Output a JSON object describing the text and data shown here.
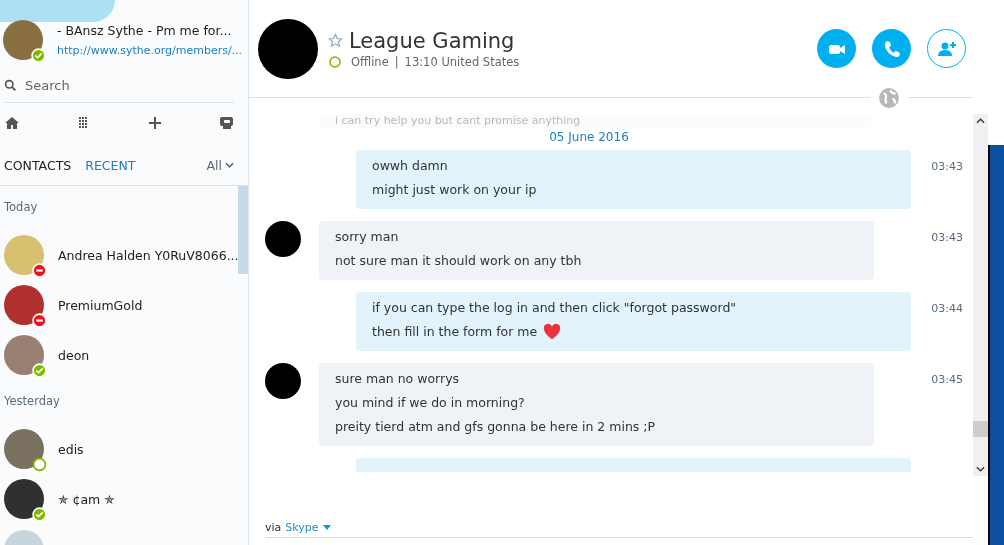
{
  "profile": {
    "name": "- BAnsz Sythe - Pm me for...",
    "mood": "http://www.sythe.org/members/...",
    "kind": "online"
  },
  "search": {
    "placeholder": "Search"
  },
  "tabs": [
    {
      "label": "CONTACTS",
      "selected": false
    },
    {
      "label": "RECENT",
      "selected": true
    }
  ],
  "filter": {
    "label": "All"
  },
  "groups": [
    {
      "label": "Today",
      "contacts": [
        {
          "name": "Andrea Halden Y0RuV8066...",
          "kind": "busy",
          "color": "#d8c070"
        },
        {
          "name": "PremiumGold",
          "kind": "busy",
          "color": "#b03030"
        },
        {
          "name": "deon",
          "kind": "online",
          "color": "#9a8070"
        }
      ]
    },
    {
      "label": "Yesterday",
      "contacts": [
        {
          "name": "edis",
          "kind": "offline",
          "color": "#7a7060"
        },
        {
          "name": "✯ ¢am ✯",
          "kind": "online",
          "color": "#303030"
        }
      ]
    }
  ],
  "chat": {
    "title": "League Gaming",
    "favorite": false,
    "kind": "offline",
    "status_text": "Offline",
    "separator": "|",
    "time_location": "13:10 United States"
  },
  "faded_message": "i can try help you but cant promise anything",
  "date": "05 June 2016",
  "messages": [
    {
      "kind": "sent",
      "lines": [
        "owwh damn",
        "might just work on your ip"
      ],
      "time": "03:43"
    },
    {
      "kind": "received",
      "lines": [
        "sorry man",
        "not sure man it should work on any tbh"
      ],
      "time": "03:43"
    },
    {
      "kind": "sent",
      "lines": [
        "if you can type the log in and then click \"forgot password\"",
        "then fill in the form for me"
      ],
      "heart": true,
      "time": "03:44"
    },
    {
      "kind": "received",
      "lines": [
        "sure man no worrys",
        "you mind if we do in morning?",
        "preity tierd atm and gfs gonna be here in 2 mins ;P"
      ],
      "time": "03:45"
    }
  ],
  "footer": {
    "prefix": "via",
    "service": "Skype"
  }
}
